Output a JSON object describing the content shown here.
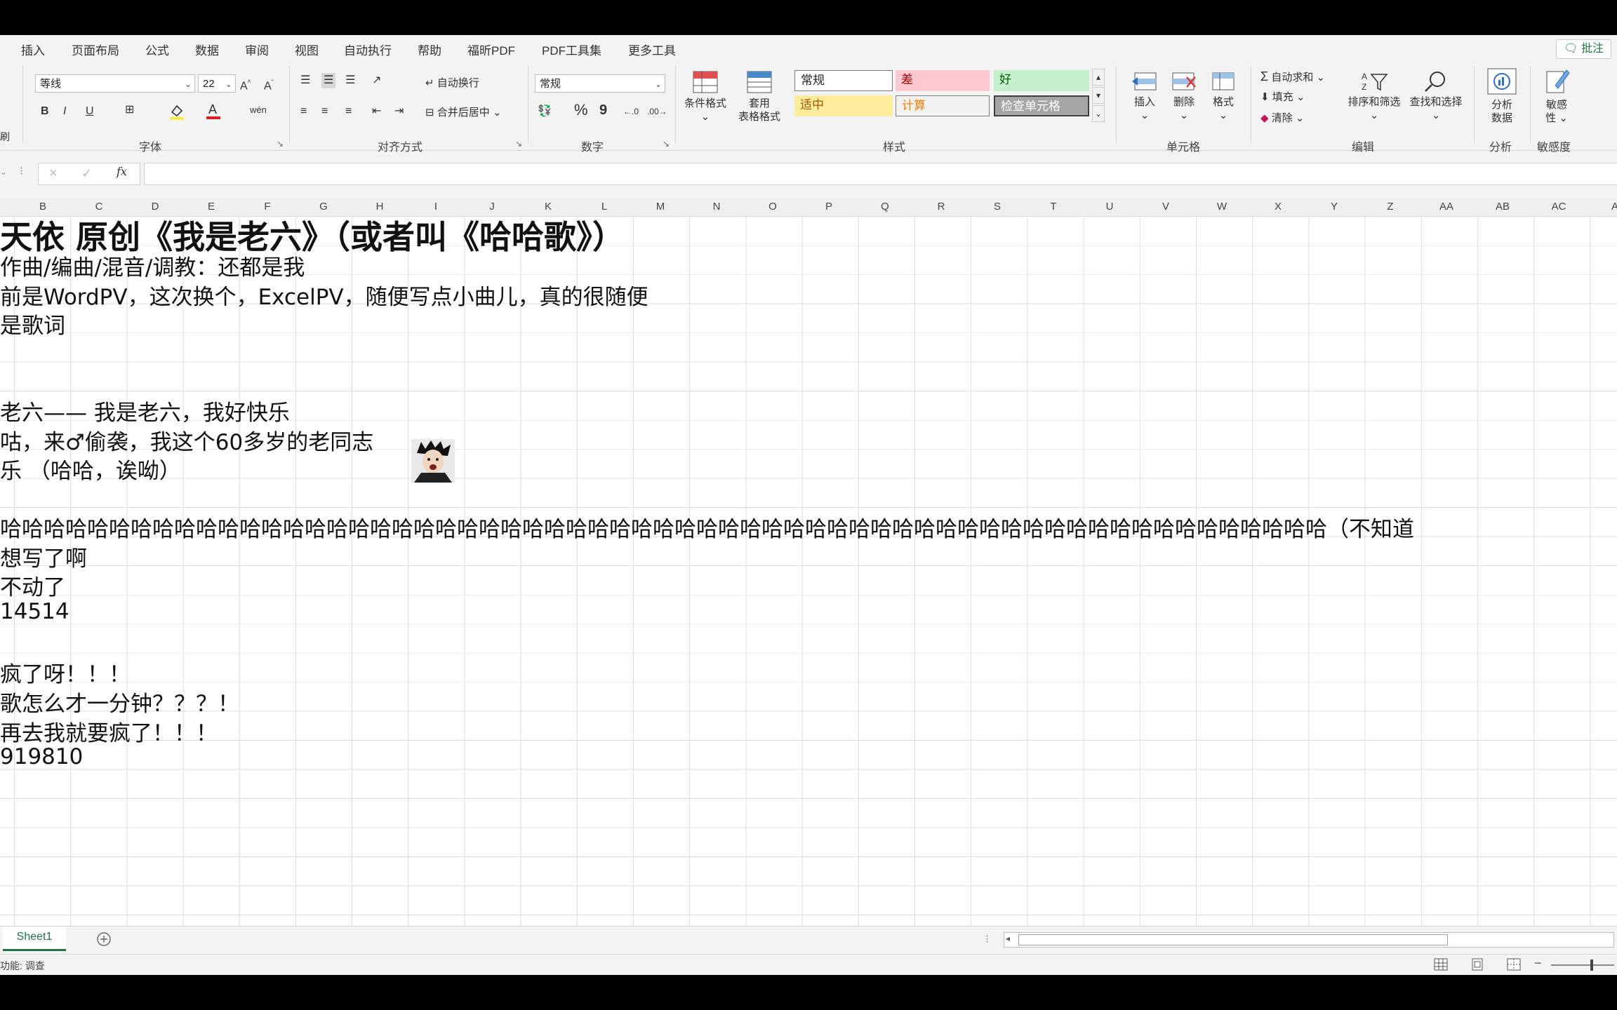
{
  "tabs": [
    "插入",
    "页面布局",
    "公式",
    "数据",
    "审阅",
    "视图",
    "自动执行",
    "帮助",
    "福昕PDF",
    "PDF工具集",
    "更多工具"
  ],
  "comment_button": "批注",
  "font": {
    "name": "等线",
    "size": "22",
    "group_label": "字体",
    "bold": "B",
    "italic": "I",
    "underline": "U",
    "grow": "A^",
    "shrink": "A˅"
  },
  "alignment": {
    "wrap": "自动换行",
    "merge": "合并后居中",
    "group_label": "对齐方式"
  },
  "number": {
    "format": "常规",
    "percent": "%",
    "comma": "9",
    "group_label": "数字"
  },
  "styles": {
    "conditional": "条件格式",
    "table_format_line1": "套用",
    "table_format_line2": "表格格式",
    "normal": "常规",
    "bad": "差",
    "good": "好",
    "neutral": "适中",
    "calc": "计算",
    "check": "检查单元格",
    "group_label": "样式",
    "colors": {
      "bad_bg": "#ffc7ce",
      "bad_fg": "#9c0006",
      "good_bg": "#c6efce",
      "good_fg": "#006100",
      "neutral_bg": "#ffeb9c",
      "neutral_fg": "#9c5700",
      "calc_bg": "#f2f2f2",
      "calc_fg": "#fa7d00",
      "check_bg": "#a5a5a5",
      "check_fg": "#ffffff"
    }
  },
  "cells": {
    "insert": "插入",
    "delete": "删除",
    "format": "格式",
    "group_label": "单元格"
  },
  "editing": {
    "autosum": "自动求和",
    "fill": "填充",
    "clear": "清除",
    "sort": "排序和筛选",
    "find": "查找和选择",
    "group_label": "编辑"
  },
  "analysis": {
    "label_line1": "分析",
    "label_line2": "数据",
    "group_label": "分析"
  },
  "sensitivity": {
    "label_line1": "敏感",
    "label_line2": "性",
    "group_label": "敏感度"
  },
  "formula_bar": {
    "fx": "fx",
    "cancel": "×",
    "enter": "✓"
  },
  "columns": [
    "B",
    "C",
    "D",
    "E",
    "F",
    "G",
    "H",
    "I",
    "J",
    "K",
    "L",
    "M",
    "N",
    "O",
    "P",
    "Q",
    "R",
    "S",
    "T",
    "U",
    "V",
    "W",
    "X",
    "Y",
    "Z",
    "AA",
    "AB",
    "AC",
    "A"
  ],
  "rows": [
    "天依 原创《我是老六》（或者叫《哈哈歌》）",
    "作曲/编曲/混音/调教：还都是我",
    "前是WordPV，这次换个，ExcelPV，随便写点小曲儿，真的很随便",
    "是歌词",
    "",
    "",
    "老六—— 我是老六，我好快乐",
    "咕，来♂偷袭，我这个60多岁的老同志",
    "乐 （哈哈，诶呦）",
    "",
    "哈哈哈哈哈哈哈哈哈哈哈哈哈哈哈哈哈哈哈哈哈哈哈哈哈哈哈哈哈哈哈哈哈哈哈哈哈哈哈哈哈哈哈哈哈哈哈哈哈哈哈哈哈哈哈哈哈哈哈哈哈（不知道",
    "想写了啊",
    "不动了",
    "14514",
    "",
    "疯了呀！！！",
    "歌怎么才一分钟？？？！",
    "再去我就要疯了！！！",
    "919810"
  ],
  "sheet_tab": "Sheet1",
  "status": "功能: 调查"
}
